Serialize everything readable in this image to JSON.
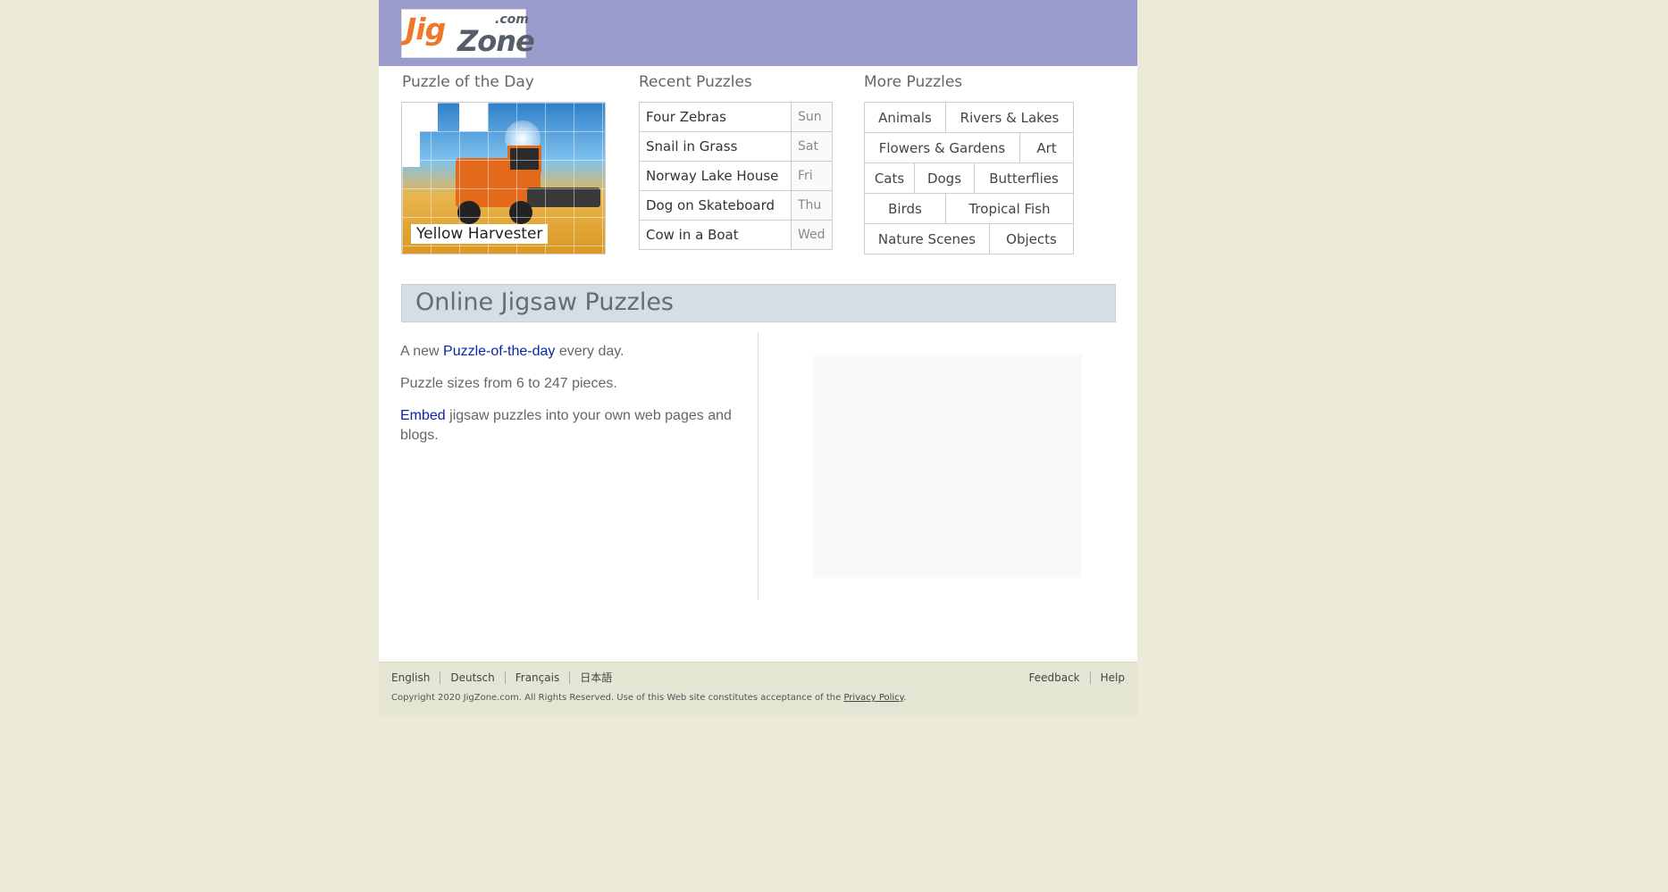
{
  "logo": {
    "jig": "Jig",
    "zone": "Zone",
    "com": ".com"
  },
  "potd": {
    "title": "Puzzle of the Day",
    "label": "Yellow Harvester"
  },
  "recent": {
    "title": "Recent Puzzles",
    "items": [
      {
        "name": "Four Zebras",
        "day": "Sun"
      },
      {
        "name": "Snail in Grass",
        "day": "Sat"
      },
      {
        "name": "Norway Lake House",
        "day": "Fri"
      },
      {
        "name": "Dog on Skateboard",
        "day": "Thu"
      },
      {
        "name": "Cow in a Boat",
        "day": "Wed"
      }
    ]
  },
  "more": {
    "title": "More Puzzles",
    "rows": [
      [
        "Animals",
        "Rivers & Lakes"
      ],
      [
        "Flowers & Gardens",
        "Art"
      ],
      [
        "Cats",
        "Dogs",
        "Butterflies"
      ],
      [
        "Birds",
        "Tropical Fish"
      ],
      [
        "Nature Scenes",
        "Objects"
      ]
    ]
  },
  "banner": {
    "title": "Online Jigsaw Puzzles"
  },
  "info": {
    "line1_prefix": "A new ",
    "line1_link": "Puzzle-of-the-day",
    "line1_suffix": " every day.",
    "line2": "Puzzle sizes from 6 to 247 pieces.",
    "line3_link": "Embed",
    "line3_suffix": " jigsaw puzzles into your own web pages and blogs."
  },
  "footer": {
    "languages": [
      "English",
      "Deutsch",
      "Français",
      "日本語"
    ],
    "feedback": "Feedback",
    "help": "Help",
    "copyright_prefix": "Copyright 2020 JigZone.com. All Rights Reserved. Use of this Web site constitutes acceptance of the ",
    "privacy": "Privacy Policy",
    "copyright_suffix": "."
  }
}
